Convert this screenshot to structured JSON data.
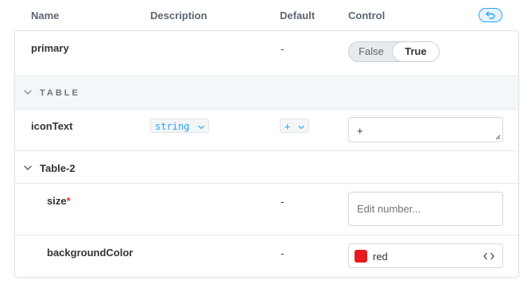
{
  "header": {
    "name": "Name",
    "description": "Description",
    "default": "Default",
    "control": "Control",
    "reset_icon": "undo-icon"
  },
  "rows": {
    "primary": {
      "name": "primary",
      "default": "-",
      "toggle": {
        "false_label": "False",
        "true_label": "True",
        "selected": "True"
      }
    },
    "section": {
      "label": "TABLE",
      "icon": "chevron-down-icon"
    },
    "iconText": {
      "name": "iconText",
      "type": "string",
      "default": "+",
      "value": "+"
    },
    "group": {
      "label": "Table-2",
      "icon": "chevron-down-icon"
    },
    "size": {
      "name": "size",
      "required": "*",
      "default": "-",
      "placeholder": "Edit number..."
    },
    "backgroundColor": {
      "name": "backgroundColor",
      "default": "-",
      "color_value": "red",
      "swatch": "#e8191f",
      "toggle_icon": "code-icon"
    }
  },
  "colors": {
    "accent": "#1ea7fd",
    "section_bg": "#f4f7f9",
    "required": "#e7372f"
  }
}
